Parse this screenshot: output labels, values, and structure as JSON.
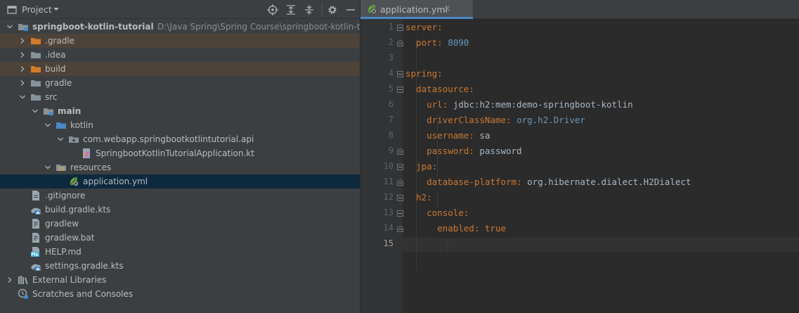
{
  "project_panel": {
    "title": "Project",
    "header_buttons": [
      "locate-icon",
      "expand-all-icon",
      "collapse-all-icon",
      "gear-icon",
      "minimize-icon"
    ]
  },
  "tree": [
    {
      "label": "springboot-kotlin-tutorial",
      "hint": "D:\\Java Spring\\Spring Course\\springboot-kotlin-tutorial",
      "icon": "module-folder-icon",
      "arrow": "down",
      "bold": true
    },
    {
      "label": ".gradle",
      "icon": "excluded-folder-icon",
      "arrow": "right",
      "excluded": true
    },
    {
      "label": ".idea",
      "icon": "folder-icon",
      "arrow": "right"
    },
    {
      "label": "build",
      "icon": "excluded-folder-icon",
      "arrow": "right",
      "excluded": true
    },
    {
      "label": "gradle",
      "icon": "folder-icon",
      "arrow": "right"
    },
    {
      "label": "src",
      "icon": "folder-icon",
      "arrow": "down"
    },
    {
      "label": "main",
      "icon": "module-folder-icon",
      "arrow": "down",
      "bold": true
    },
    {
      "label": "kotlin",
      "icon": "source-folder-icon",
      "arrow": "down"
    },
    {
      "label": "com.webapp.springbootkotlintutorial.api",
      "icon": "package-icon",
      "arrow": "down"
    },
    {
      "label": "SpringbootKotlinTutorialApplication.kt",
      "icon": "kotlin-file-icon"
    },
    {
      "label": "resources",
      "icon": "resources-folder-icon",
      "arrow": "down"
    },
    {
      "label": "application.yml",
      "icon": "spring-yml-icon",
      "selected": true
    },
    {
      "label": ".gitignore",
      "icon": "gitignore-file-icon"
    },
    {
      "label": "build.gradle.kts",
      "icon": "gradle-kts-icon"
    },
    {
      "label": "gradlew",
      "icon": "text-file-icon"
    },
    {
      "label": "gradlew.bat",
      "icon": "text-file-icon"
    },
    {
      "label": "HELP.md",
      "icon": "markdown-file-icon"
    },
    {
      "label": "settings.gradle.kts",
      "icon": "gradle-kts-icon"
    },
    {
      "label": "External Libraries",
      "icon": "libraries-icon",
      "arrow": "right"
    },
    {
      "label": "Scratches and Consoles",
      "icon": "scratches-icon"
    }
  ],
  "editor": {
    "tab_label": "application.yml",
    "tab_close": "×",
    "current_line": 15,
    "lines": [
      [
        {
          "t": "server",
          "c": "k"
        },
        {
          "t": ":",
          "c": "p"
        }
      ],
      [
        {
          "t": "  port",
          "c": "k"
        },
        {
          "t": ": ",
          "c": "p"
        },
        {
          "t": "8090",
          "c": "n"
        }
      ],
      [],
      [
        {
          "t": "spring",
          "c": "k"
        },
        {
          "t": ":",
          "c": "p"
        }
      ],
      [
        {
          "t": "  datasource",
          "c": "k"
        },
        {
          "t": ":",
          "c": "p"
        }
      ],
      [
        {
          "t": "    url",
          "c": "k"
        },
        {
          "t": ": ",
          "c": "p"
        },
        {
          "t": "jdbc:h2:mem:demo-springboot-kotlin",
          "c": "v"
        }
      ],
      [
        {
          "t": "    driverClassName",
          "c": "k"
        },
        {
          "t": ": ",
          "c": "p"
        },
        {
          "t": "org.h2.Driver",
          "c": "n"
        }
      ],
      [
        {
          "t": "    username",
          "c": "k"
        },
        {
          "t": ": ",
          "c": "p"
        },
        {
          "t": "sa",
          "c": "v"
        }
      ],
      [
        {
          "t": "    password",
          "c": "k"
        },
        {
          "t": ": ",
          "c": "p"
        },
        {
          "t": "password",
          "c": "v"
        }
      ],
      [
        {
          "t": "  jpa",
          "c": "k"
        },
        {
          "t": ":",
          "c": "p"
        }
      ],
      [
        {
          "t": "    database-platform",
          "c": "k"
        },
        {
          "t": ": ",
          "c": "p"
        },
        {
          "t": "org.hibernate.dialect.H2Dialect",
          "c": "v"
        }
      ],
      [
        {
          "t": "  h2",
          "c": "k"
        },
        {
          "t": ":",
          "c": "p"
        }
      ],
      [
        {
          "t": "    console",
          "c": "k"
        },
        {
          "t": ":",
          "c": "p"
        }
      ],
      [
        {
          "t": "      enabled",
          "c": "k"
        },
        {
          "t": ": ",
          "c": "p"
        },
        {
          "t": "true",
          "c": "b"
        }
      ],
      []
    ]
  },
  "colors": {
    "panel_bg": "#3c3f41",
    "editor_bg": "#2b2b2b",
    "selection": "#0d293e",
    "excluded": "#4d4339",
    "yaml_key": "#cc7832",
    "yaml_value": "#a9b7c6",
    "yaml_number": "#6897bb",
    "tab_underline": "#4a88c7"
  }
}
